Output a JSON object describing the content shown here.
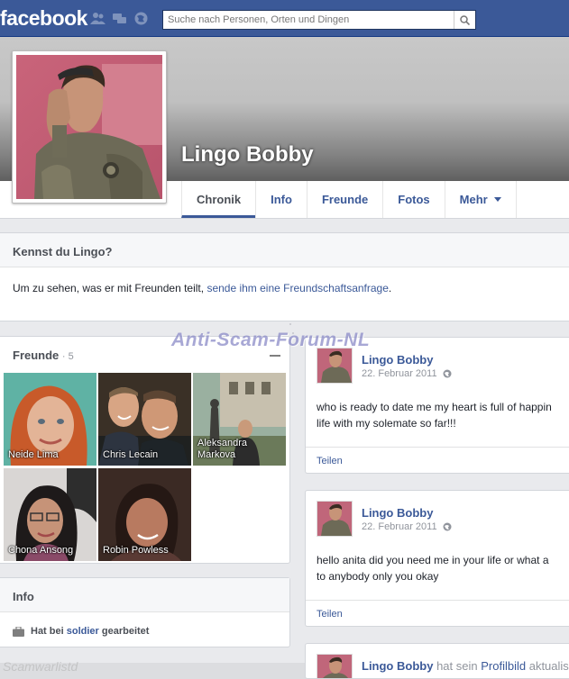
{
  "topbar": {
    "logo": "facebook",
    "search_placeholder": "Suche nach Personen, Orten und Dingen",
    "jewels": [
      "friend-requests-icon",
      "messages-icon",
      "notifications-icon"
    ],
    "brand_color": "#3b5998"
  },
  "profile": {
    "name": "Lingo Bobby",
    "tabs": [
      {
        "label": "Chronik",
        "active": true
      },
      {
        "label": "Info"
      },
      {
        "label": "Freunde"
      },
      {
        "label": "Fotos"
      },
      {
        "label": "Mehr"
      }
    ]
  },
  "know": {
    "title": "Kennst du Lingo?",
    "text": "Um zu sehen, was er mit Freunden teilt,",
    "link": "sende ihm eine Freundschaftsanfrage",
    "end": "."
  },
  "watermark": "Anti-Scam-Forum-NL",
  "friends": {
    "title": "Freunde",
    "count": "· 5",
    "items": [
      {
        "name": "Neide Lima"
      },
      {
        "name": "Chris Lecain"
      },
      {
        "name": "Aleksandra Markova"
      },
      {
        "name": "Chona Ansong"
      },
      {
        "name": "Robin Powless"
      }
    ]
  },
  "info": {
    "title": "Info",
    "work_prefix": "Hat bei",
    "work_link": "soldier",
    "work_suffix": "gearbeitet"
  },
  "posts": [
    {
      "author": "Lingo Bobby",
      "date": "22. Februar 2011",
      "lines": [
        "who is ready to date me my heart is full of happin",
        "life with my solemate so far!!!"
      ],
      "share": "Teilen"
    },
    {
      "author": "Lingo Bobby",
      "date": "22. Februar 2011",
      "lines": [
        "hello anita did you need me in your life or what a",
        "to anybody only you okay"
      ],
      "share": "Teilen"
    },
    {
      "author": "Lingo Bobby",
      "action": "hat sein",
      "action_link": "Profilbild",
      "action_end": "aktualisiert"
    }
  ],
  "corner_watermark": "Scamwarlistd"
}
